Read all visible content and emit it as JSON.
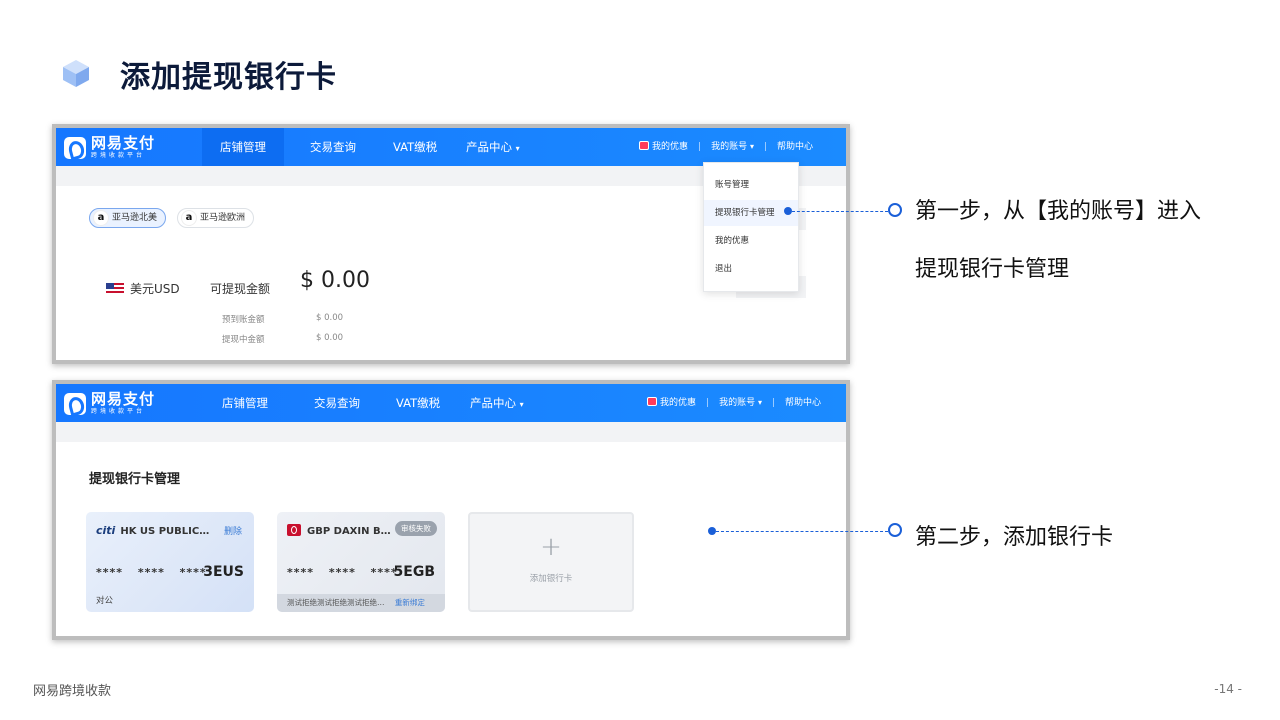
{
  "slide": {
    "title": "添加提现银行卡",
    "footer_left": "网易跨境收款",
    "page_number": "-14 -"
  },
  "colors": {
    "brand_blue": "#1677ff",
    "accent_blue": "#1a5fd8",
    "title_navy": "#0c1a3a"
  },
  "app": {
    "logo_main": "网易支付",
    "logo_sub": "跨境收款平台",
    "nav": [
      "店铺管理",
      "交易查询",
      "VAT缴税",
      "产品中心"
    ],
    "caret": "▾",
    "right_nav": {
      "offers": "我的优惠",
      "account": "我的账号",
      "help": "帮助中心",
      "separator": "|"
    }
  },
  "shot1": {
    "stores": [
      "亚马逊北美",
      "亚马逊欧洲"
    ],
    "amazon_icon_letter": "a",
    "currency": "美元USD",
    "balance_label": "可提现金额",
    "balance_amount": "$ 0.00",
    "rows": [
      {
        "label": "预到账金额",
        "value": "$   0.00"
      },
      {
        "label": "提现中金额",
        "value": "$   0.00"
      }
    ],
    "account_menu": [
      "账号管理",
      "提现银行卡管理",
      "我的优惠",
      "退出"
    ]
  },
  "shot2": {
    "section_title": "提现银行卡管理",
    "cards": [
      {
        "bank_mark": "citi",
        "bank_name": "HK US PUBLIC…",
        "action": "删除",
        "masked": "****   ****   ****",
        "tail": "3EUS",
        "type": "对公"
      },
      {
        "bank_name": "GBP DAXIN B…",
        "badge": "审核失败",
        "masked": "****   ****   ****",
        "tail": "5EGB",
        "reason": "测试拒绝测试拒绝测试拒绝…",
        "rebind": "重新绑定"
      }
    ],
    "add_card": {
      "plus": "+",
      "label": "添加银行卡"
    }
  },
  "annotations": {
    "step1_line1": "第一步，从【我的账号】进入",
    "step1_line2": "提现银行卡管理",
    "step2": "第二步，添加银行卡"
  }
}
